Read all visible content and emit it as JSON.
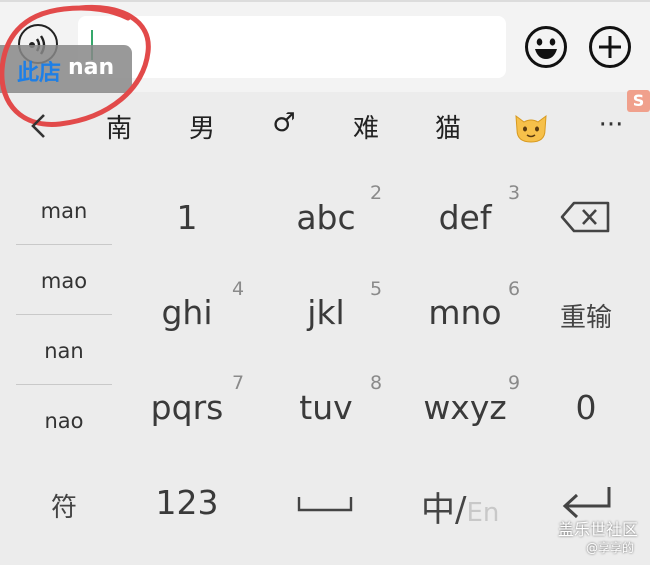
{
  "input": {
    "overlay_tag": "此店",
    "overlay_pinyin": "nan"
  },
  "candidates": [
    "南",
    "男",
    "♂",
    "难",
    "猫"
  ],
  "candidate_emoji": "🐱",
  "candidate_more": "···",
  "sidebar": [
    "man",
    "mao",
    "nan",
    "nao"
  ],
  "keys": {
    "k1": "1",
    "k2": "abc",
    "n2": "2",
    "k3": "def",
    "n3": "3",
    "k4": "ghi",
    "n4": "4",
    "k5": "jkl",
    "n5": "5",
    "k6": "mno",
    "n6": "6",
    "k7": "pqrs",
    "n7": "7",
    "k8": "tuv",
    "n8": "8",
    "k9": "wxyz",
    "n9": "9",
    "k0": "0",
    "reinput": "重输",
    "symbols": "符",
    "numbers": "123",
    "lang_cn": "中/",
    "lang_en": "En"
  },
  "watermark": {
    "line1": "盖乐世社区",
    "line2": "@享享的"
  },
  "icons": [
    "voice-icon",
    "emoji-icon",
    "plus-icon",
    "back-arrow-icon",
    "backspace-icon",
    "space-icon",
    "enter-icon"
  ],
  "colors": {
    "overlay_tag": "#1e7fe6",
    "cursor": "#35a86b",
    "annotation_circle": "#e24a4a"
  }
}
